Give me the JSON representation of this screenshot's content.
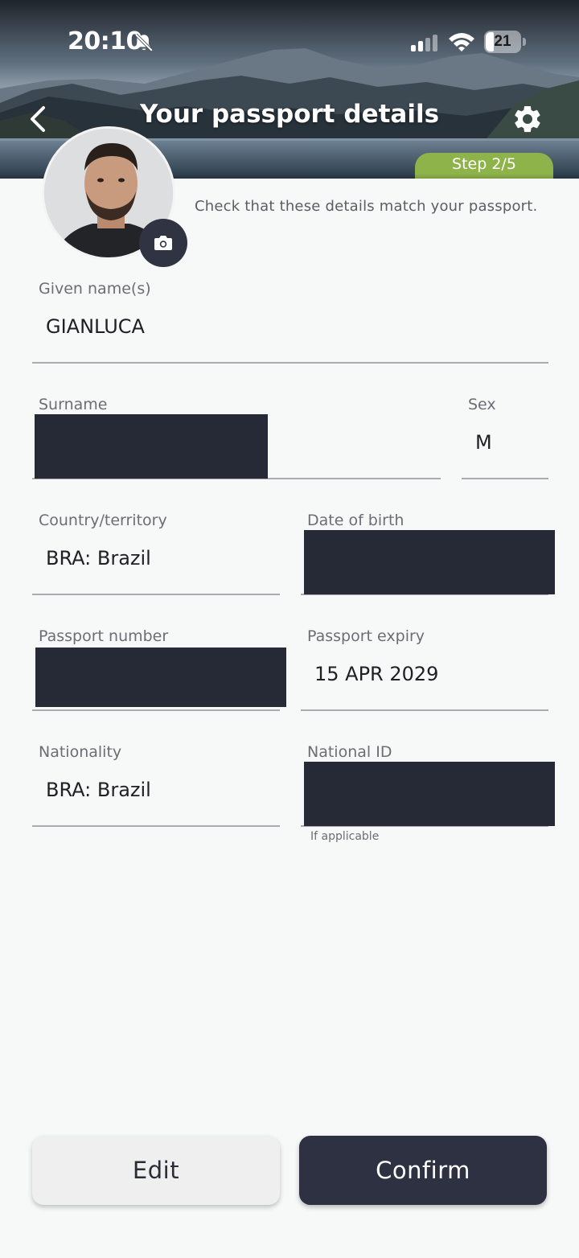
{
  "status_bar": {
    "time": "20:10",
    "battery_level": "21",
    "icons": [
      "bell-slash-icon",
      "signal-icon",
      "wifi-icon",
      "battery-icon"
    ]
  },
  "header": {
    "title": "Your passport details",
    "step": "Step 2/5",
    "back_icon": "chevron-left-icon",
    "settings_icon": "gear-icon"
  },
  "intro": "Check that these details match your passport.",
  "fields": {
    "given_names": {
      "label": "Given name(s)",
      "value": "GIANLUCA"
    },
    "surname": {
      "label": "Surname",
      "value": ""
    },
    "sex": {
      "label": "Sex",
      "value": "M"
    },
    "country": {
      "label": "Country/territory",
      "value": "BRA: Brazil"
    },
    "date_of_birth": {
      "label": "Date of birth",
      "value": ""
    },
    "passport_number": {
      "label": "Passport number",
      "value": ""
    },
    "passport_expiry": {
      "label": "Passport expiry",
      "value": "15 APR 2029"
    },
    "nationality": {
      "label": "Nationality",
      "value": "BRA: Brazil"
    },
    "national_id": {
      "label": "National ID",
      "value": "",
      "hint": "If applicable"
    }
  },
  "buttons": {
    "edit": "Edit",
    "confirm": "Confirm"
  },
  "colors": {
    "step_badge": "#8db34a",
    "primary_button": "#2e3142",
    "secondary_button": "#efefef",
    "redaction": "#252a36"
  }
}
